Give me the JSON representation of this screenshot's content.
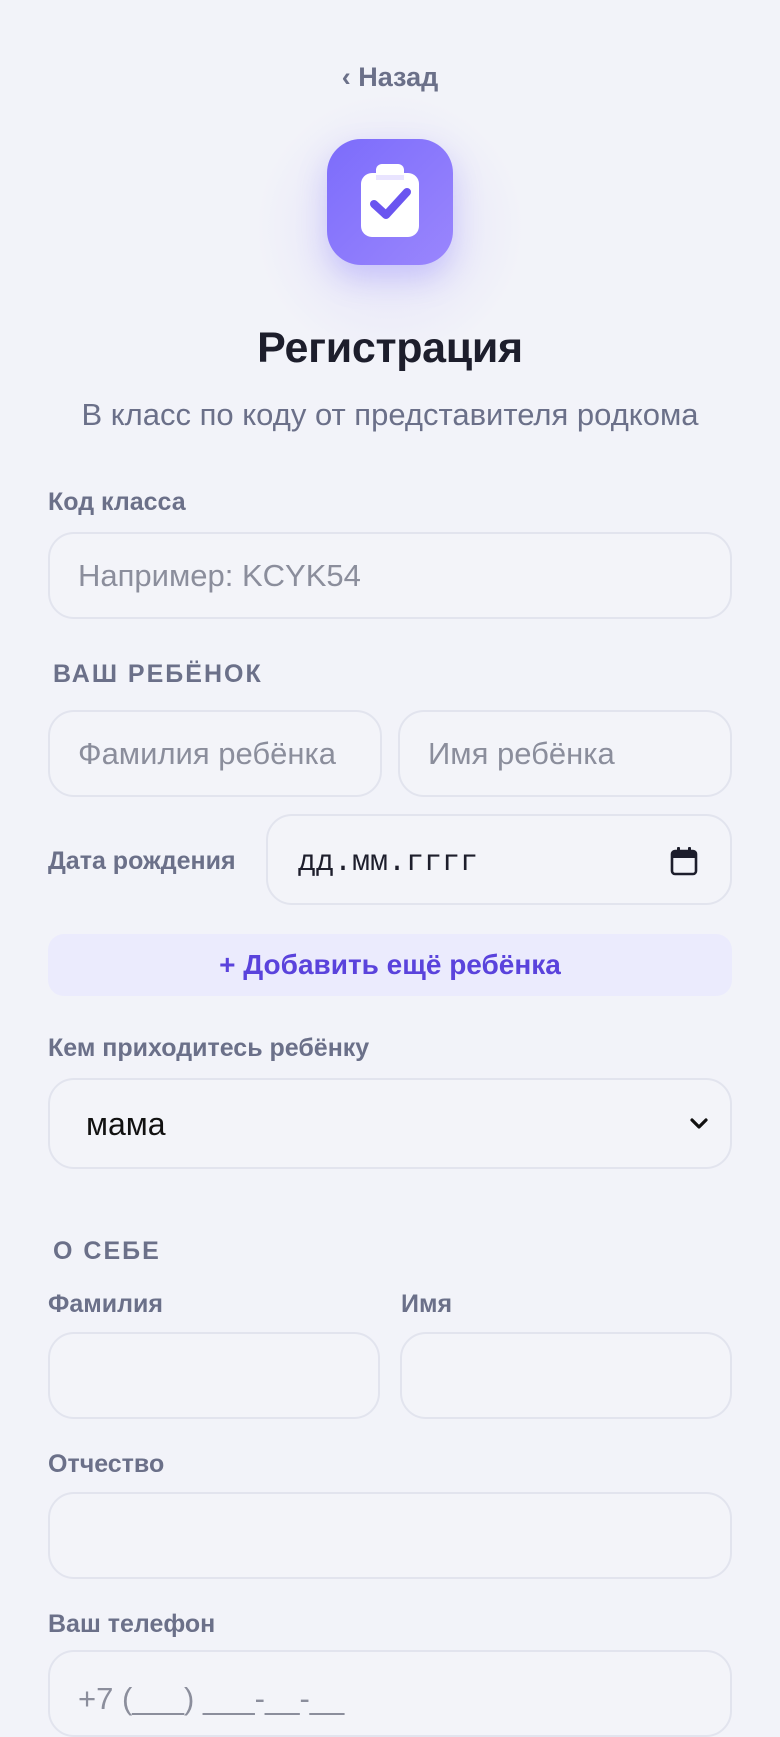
{
  "header": {
    "back_label": "‹ Назад",
    "title": "Регистрация",
    "subtitle": "В класс по коду от представителя родкома"
  },
  "class_code": {
    "label": "Код класса",
    "placeholder": "Например: KCYK54",
    "value": ""
  },
  "child_section": {
    "heading": "ВАШ РЕБЁНОК",
    "last_name_placeholder": "Фамилия ребёнка",
    "first_name_placeholder": "Имя ребёнка",
    "birth_date_label": "Дата рождения",
    "birth_date_value": "дд.мм.гггг",
    "add_child_label": "+ Добавить ещё ребёнка",
    "relation_label": "Кем приходитесь ребёнку",
    "relation_value": "мама"
  },
  "about_section": {
    "heading": "О СЕБЕ",
    "last_name_label": "Фамилия",
    "first_name_label": "Имя",
    "middle_name_label": "Отчество",
    "phone_label": "Ваш телефон",
    "phone_placeholder": "+7 (___) ___-__-__"
  },
  "colors": {
    "background": "#f2f3f9",
    "accent": "#5a43dc",
    "accent_soft": "#ebebfd",
    "logo_gradient_start": "#7c6cfb",
    "logo_gradient_end": "#9a86fd",
    "muted_text": "#6b7089",
    "title_text": "#1d1e2c"
  },
  "icons": {
    "logo": "clipboard-check-icon",
    "date_picker": "calendar-icon",
    "select": "chevron-down-icon"
  }
}
